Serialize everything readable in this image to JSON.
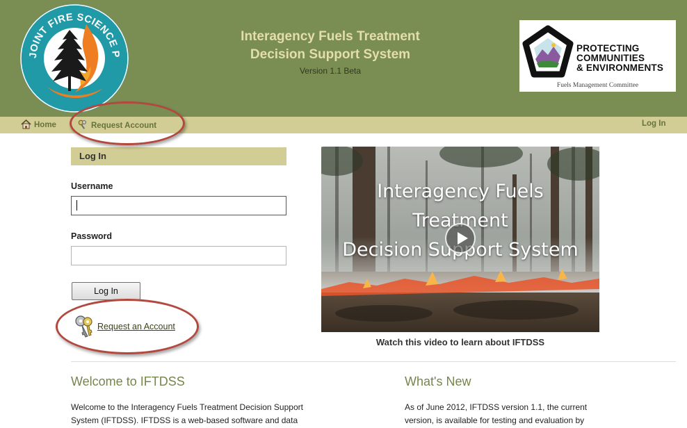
{
  "header": {
    "jfsp_logo_text": "JOINT FIRE SCIENCE PROGRAM",
    "title_line1": "Interagency Fuels Treatment",
    "title_line2": "Decision Support System",
    "version": "Version 1.1 Beta",
    "partner_logo": {
      "line1": "PROTECTING",
      "line2": "COMMUNITIES",
      "line3": "& ENVIRONMENTS",
      "subtitle": "Fuels Management Committee"
    },
    "colors": {
      "header_bg": "#7a8d53",
      "title": "#e3deaa",
      "nav_bg": "#d2cd94"
    }
  },
  "nav": {
    "home": "Home",
    "request_account": "Request Account",
    "login": "Log In"
  },
  "login": {
    "heading": "Log In",
    "username_label": "Username",
    "username_value": "",
    "password_label": "Password",
    "password_value": "",
    "button_label": "Log In",
    "request_link": "Request an Account"
  },
  "video": {
    "overlay_line1": "Interagency Fuels",
    "overlay_line2": "Treatment",
    "overlay_line3": "Decision Support System",
    "caption": "Watch this video to learn about IFTDSS"
  },
  "welcome": {
    "title": "Welcome to IFTDSS",
    "body": "Welcome to the Interagency Fuels Treatment Decision Support System (IFTDSS). IFTDSS is a web-based software and data"
  },
  "whats_new": {
    "title": "What's New",
    "body": "As of June 2012, IFTDSS version 1.1, the current version, is available for testing and evaluation by"
  },
  "annotations": {
    "ellipse_color": "#b2483e"
  }
}
